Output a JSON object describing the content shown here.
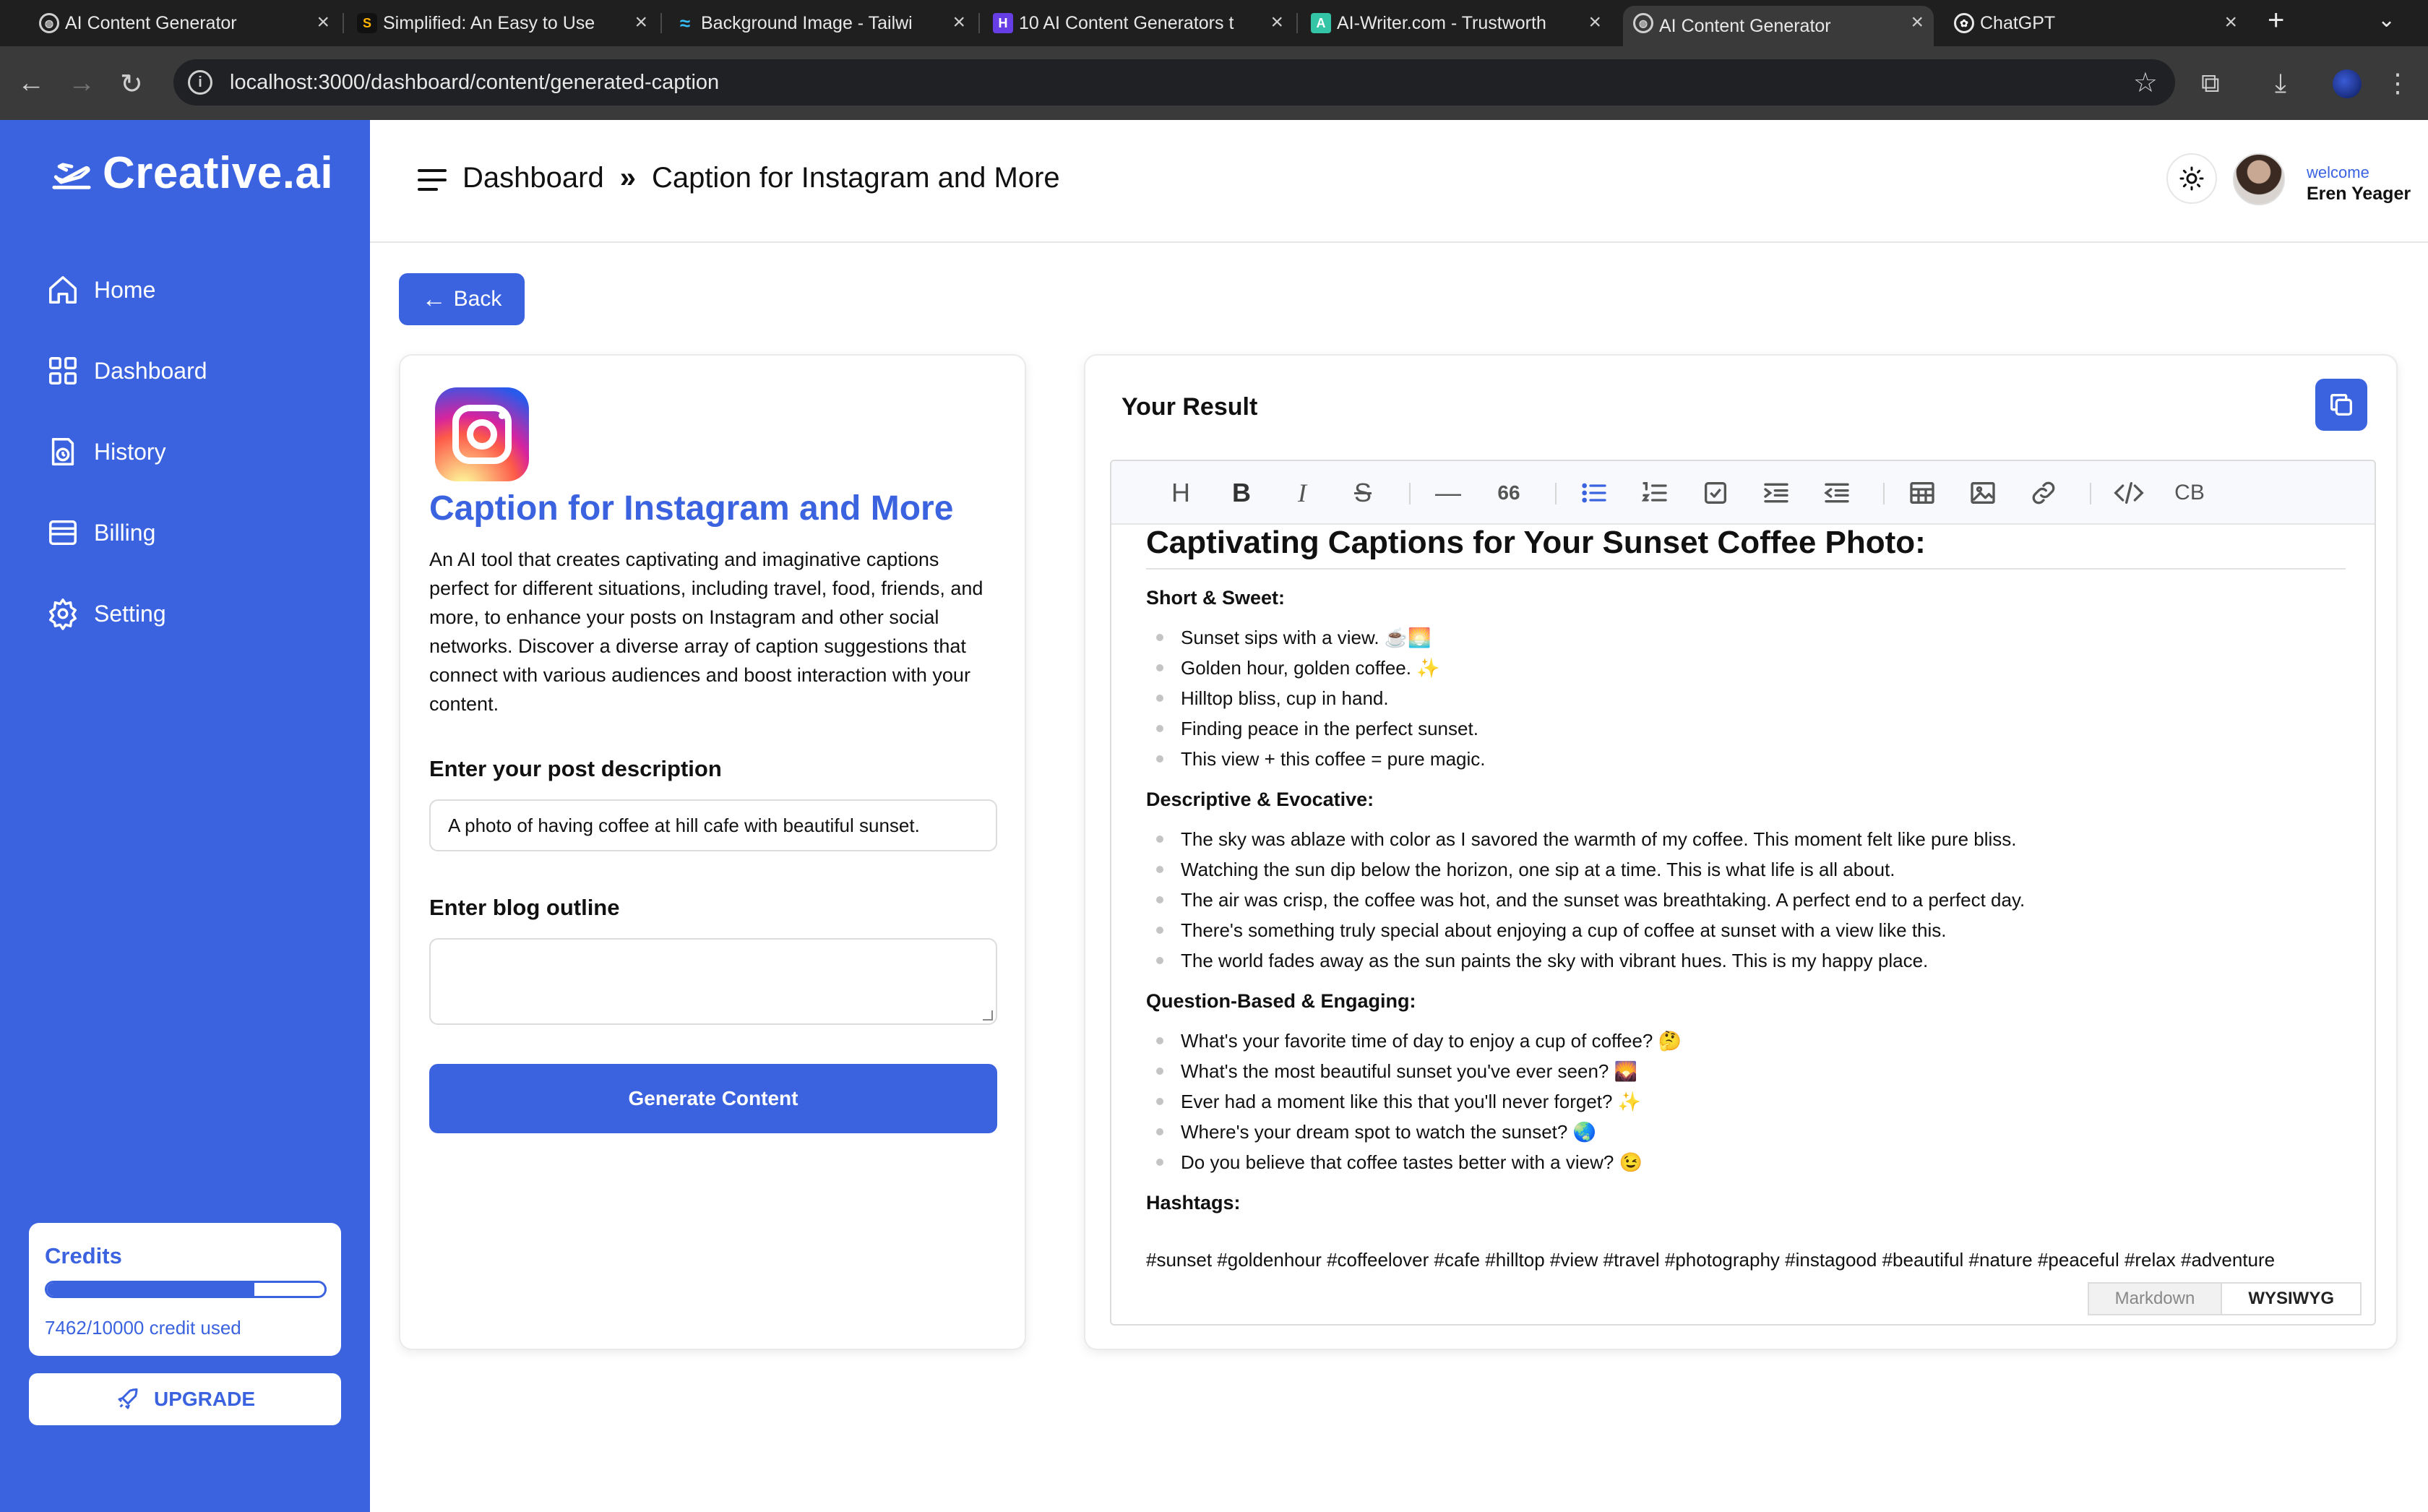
{
  "browser": {
    "tabs": [
      {
        "title": "AI Content Generator",
        "active": false,
        "icon": "globe-icon"
      },
      {
        "title": "Simplified: An Easy to Use",
        "active": false,
        "icon": "simplified-icon"
      },
      {
        "title": "Background Image - Tailwi",
        "active": false,
        "icon": "tailwind-icon"
      },
      {
        "title": "10 AI Content Generators t",
        "active": false,
        "icon": "hostinger-icon"
      },
      {
        "title": "AI-Writer.com - Trustworth",
        "active": false,
        "icon": "aiwriter-icon"
      },
      {
        "title": "AI Content Generator",
        "active": true,
        "icon": "globe-icon"
      },
      {
        "title": "ChatGPT",
        "active": false,
        "icon": "chatgpt-icon"
      }
    ],
    "url": "localhost:3000/dashboard/content/generated-caption"
  },
  "sidebar": {
    "brand": "Creative.ai",
    "items": [
      {
        "label": "Home",
        "icon": "home-icon"
      },
      {
        "label": "Dashboard",
        "icon": "dashboard-icon"
      },
      {
        "label": "History",
        "icon": "history-icon"
      },
      {
        "label": "Billing",
        "icon": "billing-icon"
      },
      {
        "label": "Setting",
        "icon": "settings-icon"
      }
    ],
    "credits": {
      "title": "Credits",
      "used": 7462,
      "total": 10000,
      "progress": 0.7462,
      "text": "7462/10000 credit used"
    },
    "upgrade_label": "UPGRADE"
  },
  "header": {
    "breadcrumb_root": "Dashboard",
    "breadcrumb_separator": "»",
    "breadcrumb_current": "Caption for Instagram and More",
    "welcome_label": "welcome",
    "user_name": "Eren Yeager"
  },
  "main": {
    "back_label": "Back",
    "form": {
      "title": "Caption for Instagram and More",
      "description": "An AI tool that creates captivating and imaginative captions perfect for different situations, including travel, food, friends, and more, to enhance your posts on Instagram and other social networks. Discover a diverse array of caption suggestions that connect with various audiences and boost interaction with your content.",
      "field1_label": "Enter your post description",
      "field1_value": "A photo of having coffee at hill cafe with beautiful sunset.",
      "field2_label": "Enter blog outline",
      "field2_value": "",
      "generate_label": "Generate Content"
    },
    "result": {
      "title": "Your Result",
      "heading": "Captivating Captions for Your Sunset Coffee Photo:",
      "sections": [
        {
          "title": "Short & Sweet:",
          "items": [
            "Sunset sips with a view. ☕🌅",
            "Golden hour, golden coffee. ✨",
            "Hilltop bliss, cup in hand.",
            "Finding peace in the perfect sunset.",
            "This view + this coffee = pure magic."
          ]
        },
        {
          "title": "Descriptive & Evocative:",
          "items": [
            "The sky was ablaze with color as I savored the warmth of my coffee. This moment felt like pure bliss.",
            "Watching the sun dip below the horizon, one sip at a time. This is what life is all about.",
            "The air was crisp, the coffee was hot, and the sunset was breathtaking. A perfect end to a perfect day.",
            "There's something truly special about enjoying a cup of coffee at sunset with a view like this.",
            "The world fades away as the sun paints the sky with vibrant hues. This is my happy place."
          ]
        },
        {
          "title": "Question-Based & Engaging:",
          "items": [
            "What's your favorite time of day to enjoy a cup of coffee? 🤔",
            "What's the most beautiful sunset you've ever seen? 🌄",
            "Ever had a moment like this that you'll never forget? ✨",
            "Where's your dream spot to watch the sunset? 🌏",
            "Do you believe that coffee tastes better with a view? 😉"
          ]
        }
      ],
      "hashtags_title": "Hashtags:",
      "hashtags": "#sunset #goldenhour #coffeelover #cafe #hilltop #view #travel #photography #instagood #beautiful #nature #peaceful #relax #adventure",
      "mode_markdown": "Markdown",
      "mode_wysiwyg": "WYSIWYG",
      "toolbar": {
        "heading": "H",
        "bold": "B",
        "italic": "I",
        "strike": "S",
        "hr": "—",
        "quote": "66",
        "codeblock": "CB"
      }
    }
  },
  "colors": {
    "accent": "#3b63e0",
    "chrome_dark": "#1f1f1f",
    "chrome_bar": "#3a3a3a"
  }
}
